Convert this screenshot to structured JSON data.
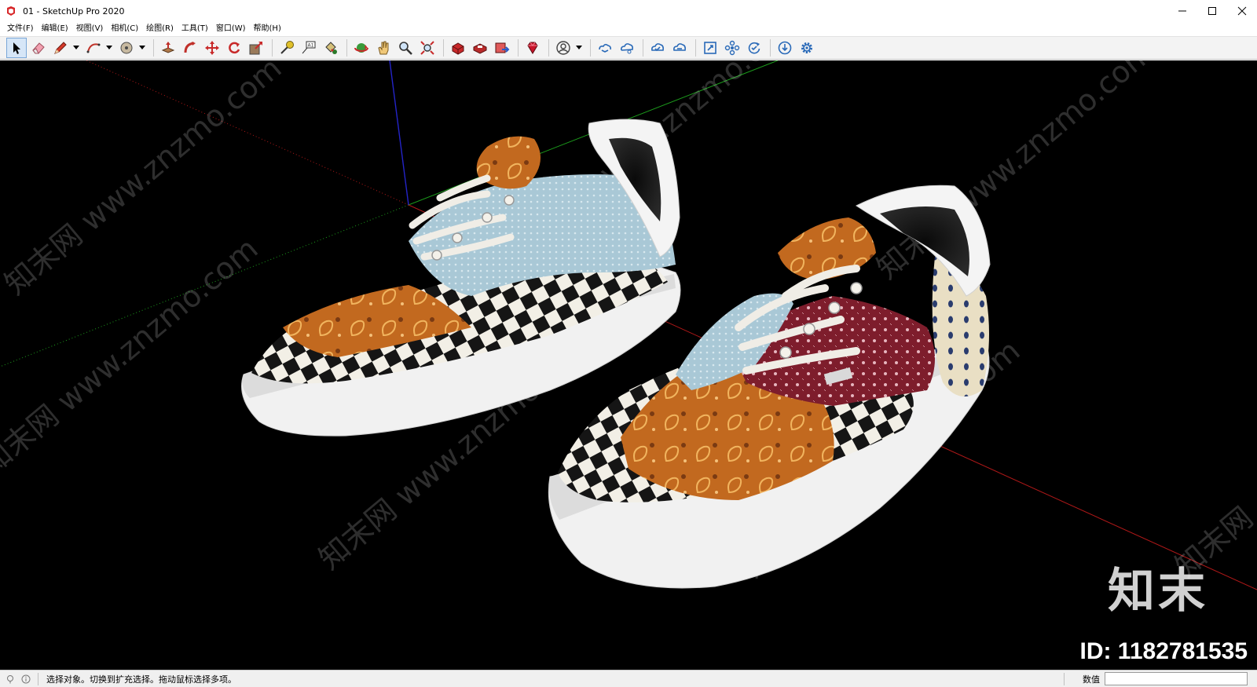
{
  "window": {
    "title": "01 - SketchUp Pro 2020",
    "minimize_label": "—",
    "maximize_label": "☐",
    "close_label": "✕"
  },
  "menu": {
    "items": [
      "文件(F)",
      "编辑(E)",
      "视图(V)",
      "相机(C)",
      "绘图(R)",
      "工具(T)",
      "窗口(W)",
      "帮助(H)"
    ]
  },
  "toolbar": {
    "tools": [
      "select-arrow-icon",
      "eraser-icon",
      "pencil-line-icon",
      "arc-icon",
      "circle-icon",
      "push-pull-icon",
      "follow-me-icon",
      "move-icon",
      "rotate-icon",
      "scale-icon",
      "tape-measure-icon",
      "text-label-icon",
      "paint-bucket-icon",
      "orbit-icon",
      "pan-hand-icon",
      "zoom-icon",
      "zoom-extents-icon",
      "3d-warehouse-icon",
      "extension-warehouse-icon",
      "layout-send-icon",
      "ruby-console-icon",
      "account-icon",
      "cloud-sync-icon",
      "cloud-share-icon",
      "cloud-upload-icon",
      "cloud-download-icon",
      "frame-icon",
      "components-icon",
      "refresh-icon",
      "import-icon",
      "settings-gear-icon"
    ]
  },
  "viewport": {
    "background": "#000000",
    "axis_colors": {
      "red": "#b01818",
      "green": "#1c9c1c",
      "blue": "#2424c8"
    },
    "watermark_text": "知末网 www.znzmo.com",
    "watermark_brand": "知末",
    "watermark_id": "ID: 1182781535"
  },
  "status": {
    "hint": "选择对象。切换到扩充选择。拖动鼠标选择多项。",
    "measure_label": "数值",
    "measure_value": ""
  }
}
